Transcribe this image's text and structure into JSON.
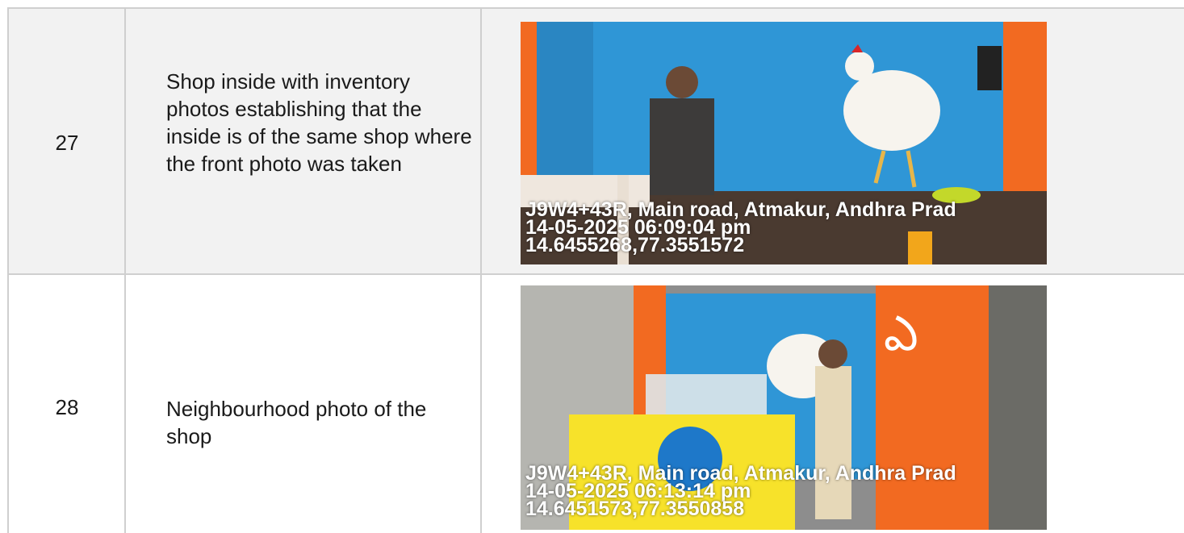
{
  "rows": [
    {
      "number": "27",
      "description": "Shop inside with inventory photos establishing that the inside is of the same shop where the front photo was taken",
      "photo": {
        "subject": "shop-interior",
        "stamp": [
          "J9W4+43R, Main road, Atmakur, Andhra Prad",
          "14-05-2025 06:09:04 pm",
          "14.6455268,77.3551572"
        ]
      }
    },
    {
      "number": "28",
      "description": "Neighbourhood photo of the shop",
      "photo": {
        "subject": "shop-front",
        "stamp": [
          "J9W4+43R, Main road, Atmakur, Andhra Prad",
          "14-05-2025 06:13:14 pm",
          "14.6451573,77.3550858"
        ]
      }
    }
  ],
  "colors": {
    "wall_blue": "#2f96d6",
    "orange": "#f26a21",
    "border": "#cfcfcf",
    "shaded_row": "#f2f2f2"
  }
}
